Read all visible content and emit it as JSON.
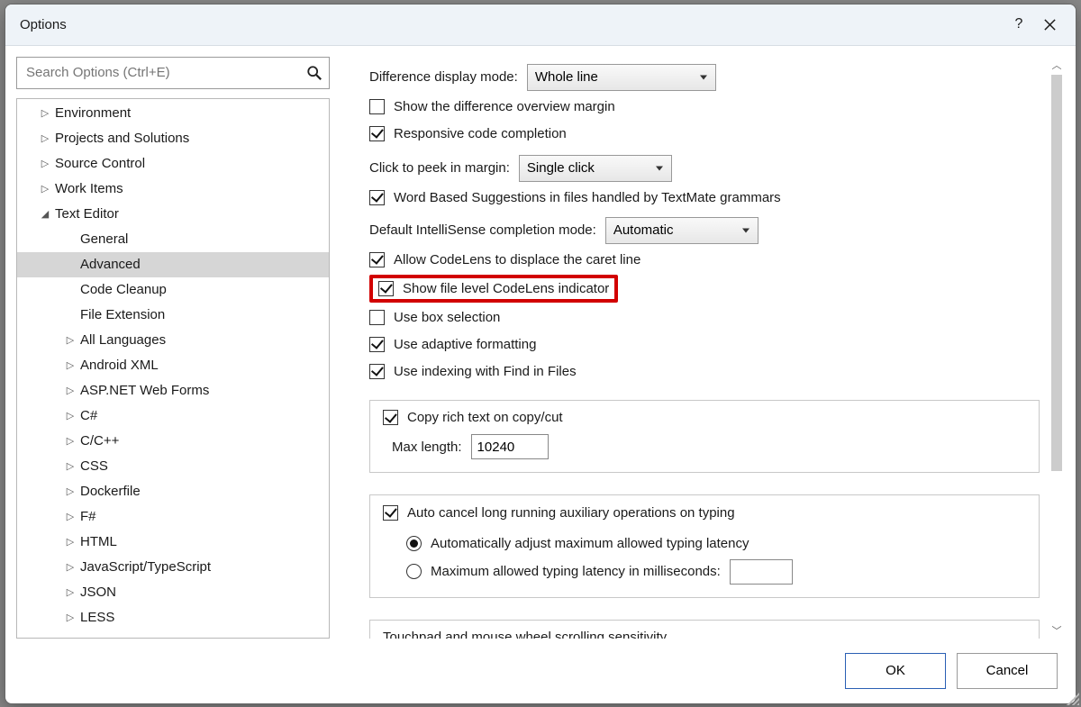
{
  "window": {
    "title": "Options"
  },
  "search": {
    "placeholder": "Search Options (Ctrl+E)"
  },
  "tree": {
    "items": [
      {
        "label": "Environment",
        "depth": 1,
        "glyph": "▷"
      },
      {
        "label": "Projects and Solutions",
        "depth": 1,
        "glyph": "▷"
      },
      {
        "label": "Source Control",
        "depth": 1,
        "glyph": "▷"
      },
      {
        "label": "Work Items",
        "depth": 1,
        "glyph": "▷"
      },
      {
        "label": "Text Editor",
        "depth": 1,
        "glyph": "◢"
      },
      {
        "label": "General",
        "depth": 2,
        "glyph": ""
      },
      {
        "label": "Advanced",
        "depth": 2,
        "glyph": "",
        "selected": true
      },
      {
        "label": "Code Cleanup",
        "depth": 2,
        "glyph": ""
      },
      {
        "label": "File Extension",
        "depth": 2,
        "glyph": ""
      },
      {
        "label": "All Languages",
        "depth": 2,
        "glyph": "▷"
      },
      {
        "label": "Android XML",
        "depth": 2,
        "glyph": "▷"
      },
      {
        "label": "ASP.NET Web Forms",
        "depth": 2,
        "glyph": "▷"
      },
      {
        "label": "C#",
        "depth": 2,
        "glyph": "▷"
      },
      {
        "label": "C/C++",
        "depth": 2,
        "glyph": "▷"
      },
      {
        "label": "CSS",
        "depth": 2,
        "glyph": "▷"
      },
      {
        "label": "Dockerfile",
        "depth": 2,
        "glyph": "▷"
      },
      {
        "label": "F#",
        "depth": 2,
        "glyph": "▷"
      },
      {
        "label": "HTML",
        "depth": 2,
        "glyph": "▷"
      },
      {
        "label": "JavaScript/TypeScript",
        "depth": 2,
        "glyph": "▷"
      },
      {
        "label": "JSON",
        "depth": 2,
        "glyph": "▷"
      },
      {
        "label": "LESS",
        "depth": 2,
        "glyph": "▷"
      }
    ]
  },
  "main": {
    "diff_mode_label": "Difference display mode:",
    "diff_mode_value": "Whole line",
    "show_diff_overview": "Show the difference overview margin",
    "responsive_completion": "Responsive code completion",
    "click_peek_label": "Click to peek in margin:",
    "click_peek_value": "Single click",
    "word_based": "Word Based Suggestions in files handled by TextMate grammars",
    "intellisense_label": "Default IntelliSense completion mode:",
    "intellisense_value": "Automatic",
    "allow_codelens": "Allow CodeLens to displace the caret line",
    "show_codelens_indicator": "Show file level CodeLens indicator",
    "use_box_sel": "Use box selection",
    "use_adaptive": "Use adaptive formatting",
    "use_indexing": "Use indexing with Find in Files",
    "copy_rich": "Copy rich text on copy/cut",
    "maxlen_label": "Max length:",
    "maxlen_value": "10240",
    "auto_cancel": "Auto cancel long running auxiliary operations on typing",
    "auto_adjust": "Automatically adjust maximum allowed typing latency",
    "max_latency": "Maximum allowed typing latency in milliseconds:",
    "max_latency_value": "",
    "touchpad_label": "Touchpad and mouse wheel scrolling sensitivity"
  },
  "footer": {
    "ok": "OK",
    "cancel": "Cancel"
  }
}
